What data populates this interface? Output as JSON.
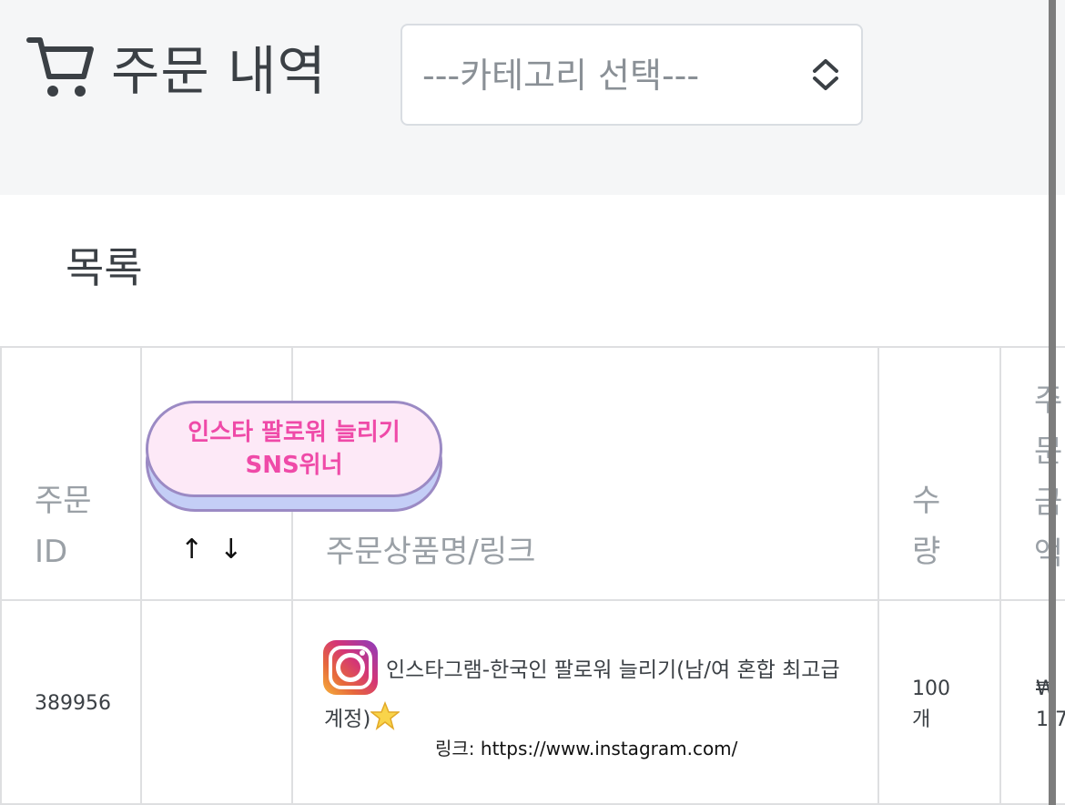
{
  "header": {
    "title": "주문 내역",
    "category_select": {
      "placeholder": "---카테고리 선택---"
    }
  },
  "list": {
    "title": "목록"
  },
  "table": {
    "headers": {
      "order_id": [
        "주문",
        "ID"
      ],
      "product": "주문상품명/링크",
      "quantity": [
        "수",
        "량"
      ],
      "amount": [
        "주",
        "문",
        "금",
        "액"
      ]
    },
    "sort_arrows": "↑↓",
    "rows": [
      {
        "order_id": "389956",
        "product_line1": "인스타그램-한국인 팔로워 늘리기(남/여 혼합 최고급",
        "product_line2": "계정)",
        "link_label": "링크:",
        "link_url": "https://www.instagram.com/",
        "quantity": [
          "100",
          "개"
        ],
        "amount_currency": "₩",
        "amount_partial": "1,7"
      }
    ]
  },
  "overlay_badge": {
    "line1": "인스타 팔로워 늘리기",
    "line2": "SNS위너"
  },
  "icons": {
    "cart": "cart-icon",
    "select_arrows": "chevron-up-down-icon",
    "instagram": "instagram-icon",
    "star": "star-icon"
  },
  "colors": {
    "header_bg": "#f5f6f7",
    "badge_text": "#ef4aa8",
    "badge_bg": "#fde9f7",
    "badge_border": "#9b8ac4"
  }
}
